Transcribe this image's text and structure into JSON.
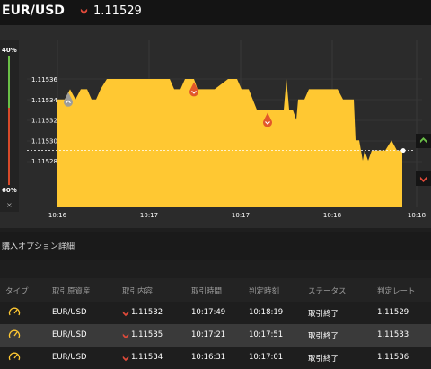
{
  "header": {
    "pair": "EUR/USD",
    "rate": "1.11529",
    "direction_icon": "down-arrow-icon"
  },
  "chart_data": {
    "type": "area",
    "y_ticks": [
      "1.11536",
      "1.11534",
      "1.11532",
      "1.11530",
      "1.11528"
    ],
    "x_ticks": [
      "10:16",
      "10:17",
      "10:17",
      "10:18",
      "10:18"
    ],
    "ylim": [
      1.11524,
      1.1154
    ],
    "area_color": "#ffc832",
    "points": [
      [
        0,
        1.11534
      ],
      [
        8,
        1.11534
      ],
      [
        14,
        1.11535
      ],
      [
        20,
        1.11534
      ],
      [
        26,
        1.11535
      ],
      [
        33,
        1.11535
      ],
      [
        38,
        1.11534
      ],
      [
        43,
        1.11534
      ],
      [
        48,
        1.11535
      ],
      [
        55,
        1.11536
      ],
      [
        70,
        1.11536
      ],
      [
        90,
        1.11536
      ],
      [
        110,
        1.11536
      ],
      [
        125,
        1.11536
      ],
      [
        130,
        1.11535
      ],
      [
        137,
        1.11535
      ],
      [
        142,
        1.11536
      ],
      [
        152,
        1.11536
      ],
      [
        156,
        1.11535
      ],
      [
        163,
        1.11535
      ],
      [
        175,
        1.11535
      ],
      [
        190,
        1.11536
      ],
      [
        200,
        1.11536
      ],
      [
        205,
        1.11535
      ],
      [
        213,
        1.11535
      ],
      [
        222,
        1.11533
      ],
      [
        236,
        1.11533
      ],
      [
        252,
        1.11533
      ],
      [
        255,
        1.11536
      ],
      [
        258,
        1.11533
      ],
      [
        262,
        1.11533
      ],
      [
        266,
        1.11532
      ],
      [
        268,
        1.11534
      ],
      [
        275,
        1.11534
      ],
      [
        280,
        1.11535
      ],
      [
        290,
        1.11535
      ],
      [
        312,
        1.11535
      ],
      [
        318,
        1.11534
      ],
      [
        322,
        1.11534
      ],
      [
        330,
        1.11534
      ],
      [
        332,
        1.1153
      ],
      [
        336,
        1.1153
      ],
      [
        340,
        1.11528
      ],
      [
        342,
        1.11529
      ],
      [
        346,
        1.11528
      ],
      [
        350,
        1.11529
      ],
      [
        355,
        1.11529
      ],
      [
        365,
        1.11529
      ],
      [
        372,
        1.1153
      ],
      [
        378,
        1.11529
      ],
      [
        384,
        1.11529
      ]
    ],
    "t_max": 384,
    "current_rate": 1.11529,
    "markers": [
      {
        "t": 12,
        "v": 1.11534,
        "color": "#9c9c9c",
        "direction": "up"
      },
      {
        "t": 152,
        "v": 1.11535,
        "color": "#e2572a",
        "direction": "down"
      },
      {
        "t": 234,
        "v": 1.11532,
        "color": "#e2572a",
        "direction": "down"
      }
    ]
  },
  "indicator": {
    "top_pct": "40%",
    "bottom_pct": "60%",
    "close": "×"
  },
  "section": {
    "title": "購入オプション詳細"
  },
  "table": {
    "headers": [
      "タイプ",
      "取引原資産",
      "取引内容",
      "取引時間",
      "判定時刻",
      "ステータス",
      "判定レート"
    ],
    "rows": [
      {
        "asset": "EUR/USD",
        "rate": "1.11532",
        "time": "10:17:49",
        "judge": "10:18:19",
        "status": "取引終了",
        "result": "1.11529"
      },
      {
        "asset": "EUR/USD",
        "rate": "1.11535",
        "time": "10:17:21",
        "judge": "10:17:51",
        "status": "取引終了",
        "result": "1.11533"
      },
      {
        "asset": "EUR/USD",
        "rate": "1.11534",
        "time": "10:16:31",
        "judge": "10:17:01",
        "status": "取引終了",
        "result": "1.11536"
      }
    ]
  },
  "colors": {
    "up": "#6abf47",
    "down": "#e04a3a",
    "accent": "#ffc832"
  }
}
